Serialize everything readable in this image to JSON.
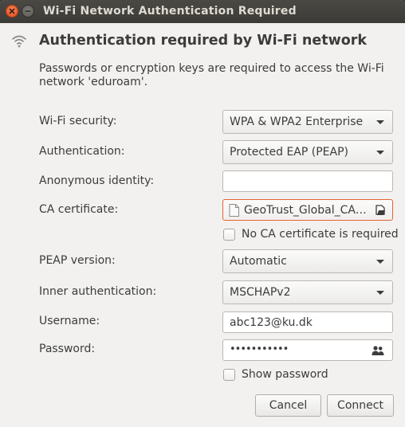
{
  "window": {
    "title": "Wi-Fi Network Authentication Required"
  },
  "header": {
    "heading": "Authentication required by Wi-Fi network",
    "description": "Passwords or encryption keys are required to access the Wi-Fi network 'eduroam'."
  },
  "form": {
    "wifi_security": {
      "label": "Wi-Fi security:",
      "value": "WPA & WPA2 Enterprise"
    },
    "authentication": {
      "label": "Authentication:",
      "value": "Protected EAP (PEAP)"
    },
    "anonymous_identity": {
      "label": "Anonymous identity:",
      "value": ""
    },
    "ca_certificate": {
      "label": "CA certificate:",
      "value": "GeoTrust_Global_CA.pem"
    },
    "no_ca_required": {
      "label": "No CA certificate is required",
      "checked": false
    },
    "peap_version": {
      "label": "PEAP version:",
      "value": "Automatic"
    },
    "inner_authentication": {
      "label": "Inner authentication:",
      "value": "MSCHAPv2"
    },
    "username": {
      "label": "Username:",
      "value": "abc123@ku.dk"
    },
    "password": {
      "label": "Password:",
      "value": "•••••••••••"
    },
    "show_password": {
      "label": "Show password",
      "checked": false
    }
  },
  "buttons": {
    "cancel": "Cancel",
    "connect": "Connect"
  },
  "icons": {
    "close": "close-icon",
    "minimize": "minimize-icon",
    "wifi": "wifi-icon",
    "document": "document-icon",
    "open_file": "open-file-icon",
    "password_users": "users-icon"
  },
  "colors": {
    "titlebar": "#3c3b37",
    "close_button": "#e0471c",
    "window_bg": "#f2f1f0",
    "error_border": "#e46432"
  }
}
